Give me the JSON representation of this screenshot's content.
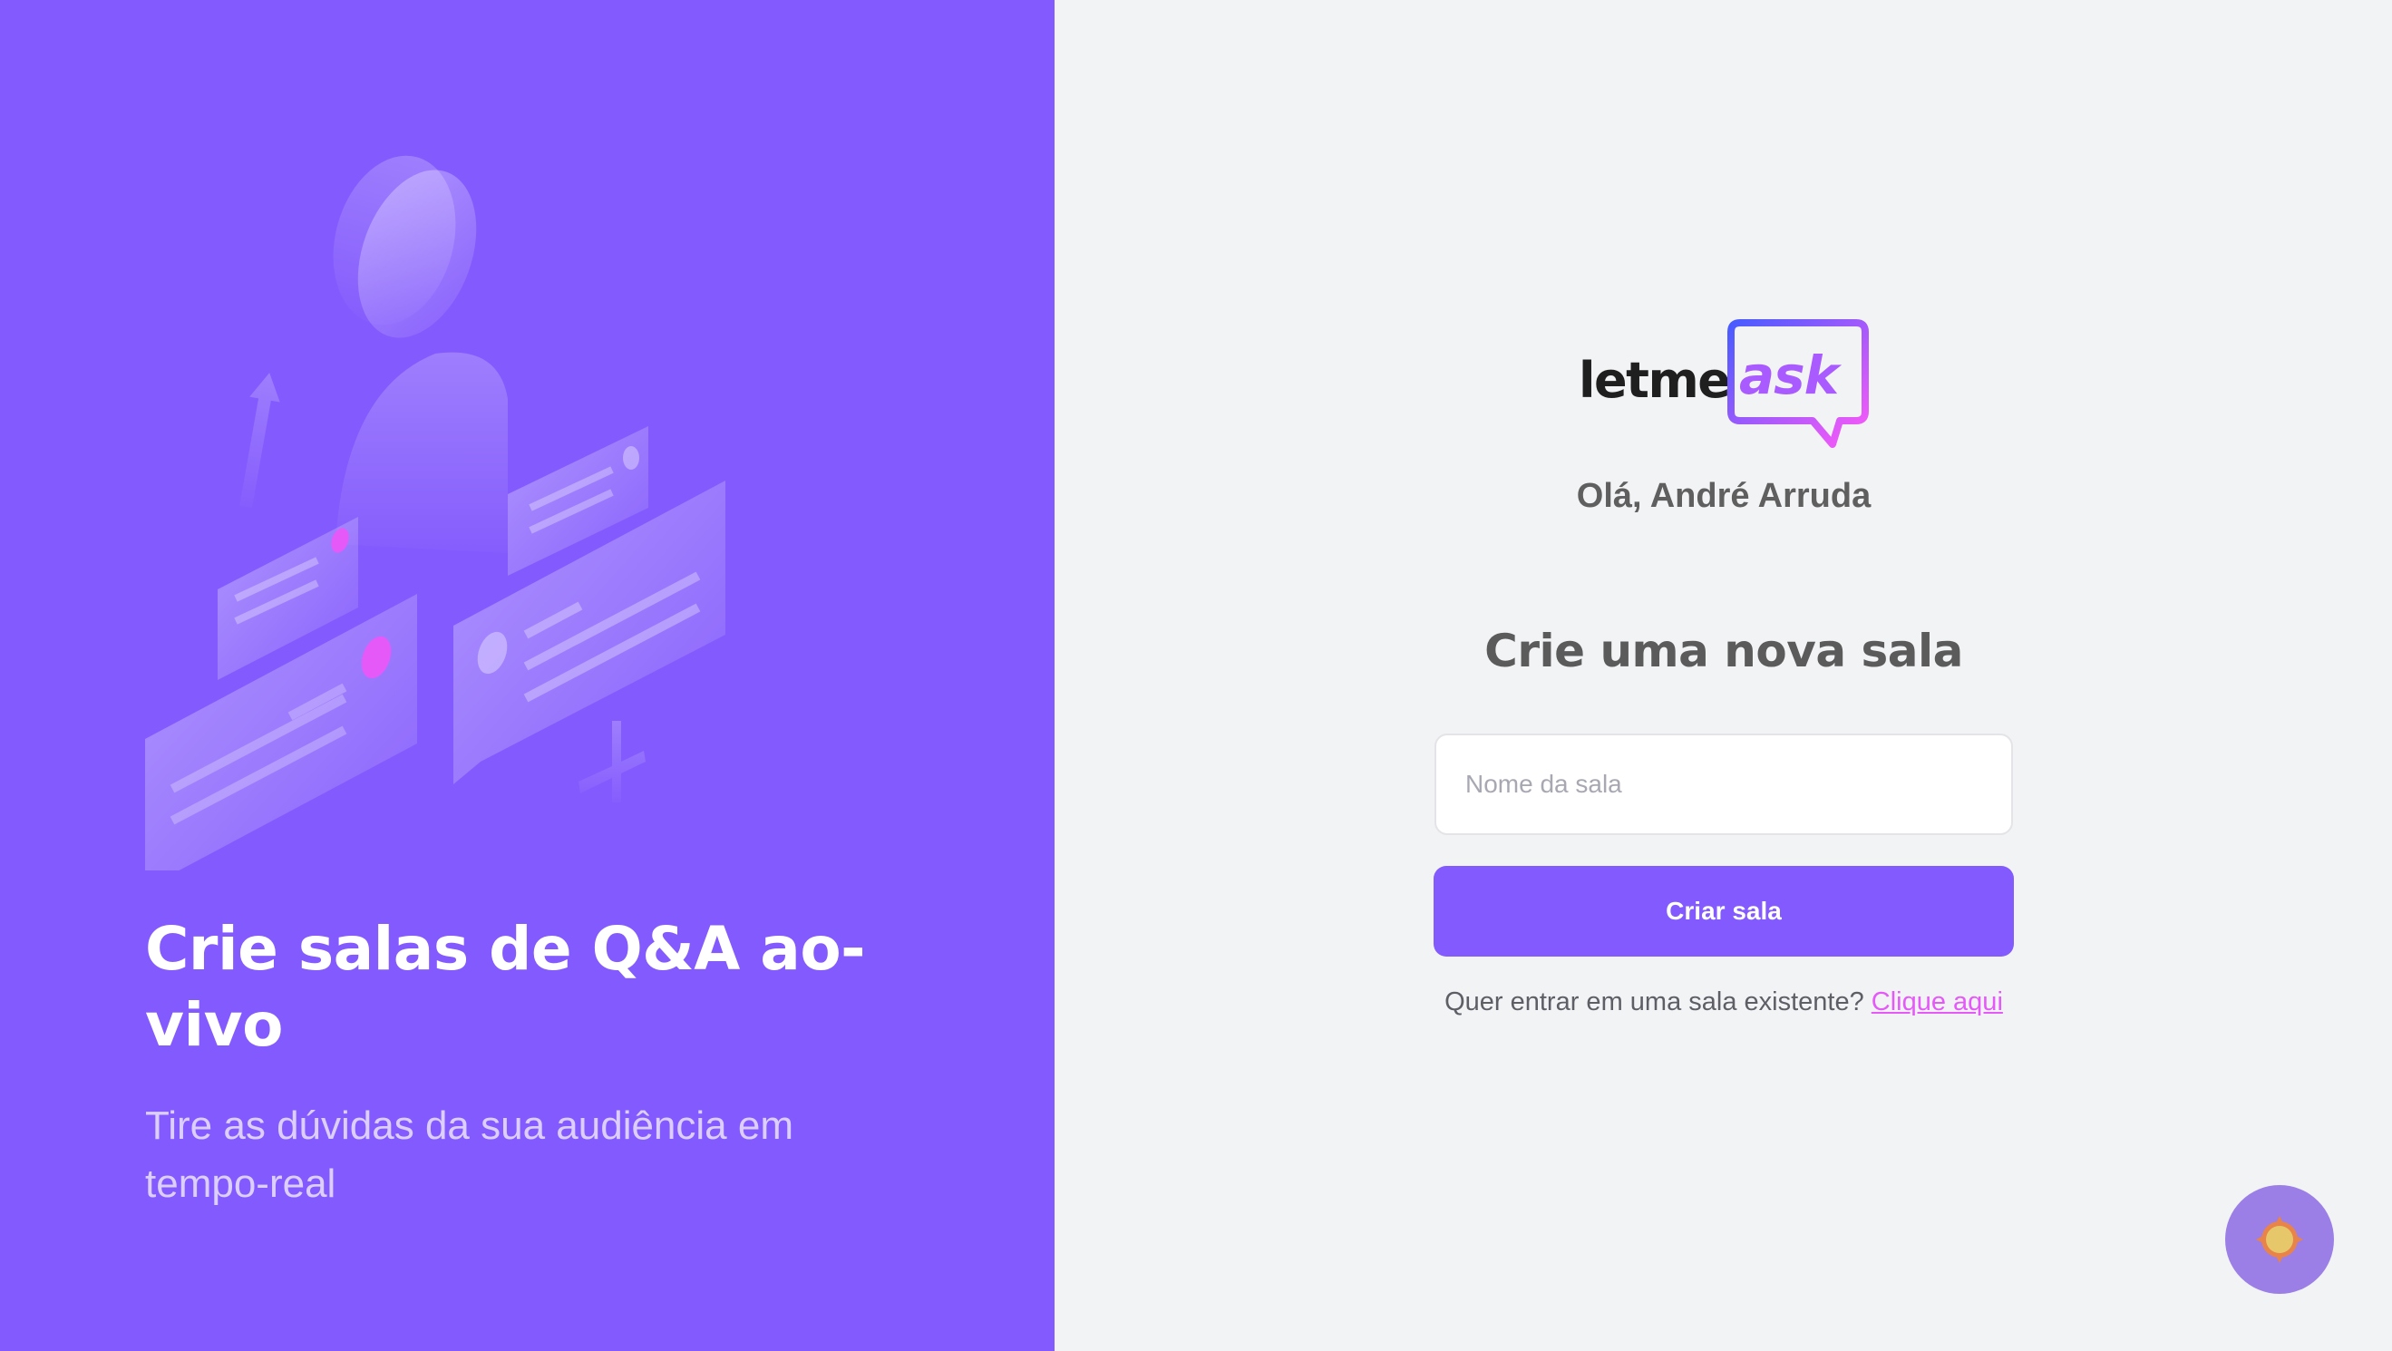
{
  "aside": {
    "title": "Crie salas de Q&A ao-vivo",
    "subtitle": "Tire as dúvidas da sua audiência em tempo-real",
    "illustration_icon": "qa-illustration"
  },
  "logo": {
    "part1": "letme",
    "part2": "ask"
  },
  "greeting": "Olá, André Arruda",
  "main": {
    "title": "Crie uma nova sala",
    "input_placeholder": "Nome da sala",
    "input_value": "",
    "create_button_label": "Criar sala",
    "join_prompt": "Quer entrar em uma sala existente?",
    "join_link_label": "Clique aqui"
  },
  "theme_toggle": {
    "icon": "sun-icon"
  },
  "colors": {
    "brand": "#835afd",
    "accent": "#e559f9",
    "background": "#f2f3f5"
  }
}
